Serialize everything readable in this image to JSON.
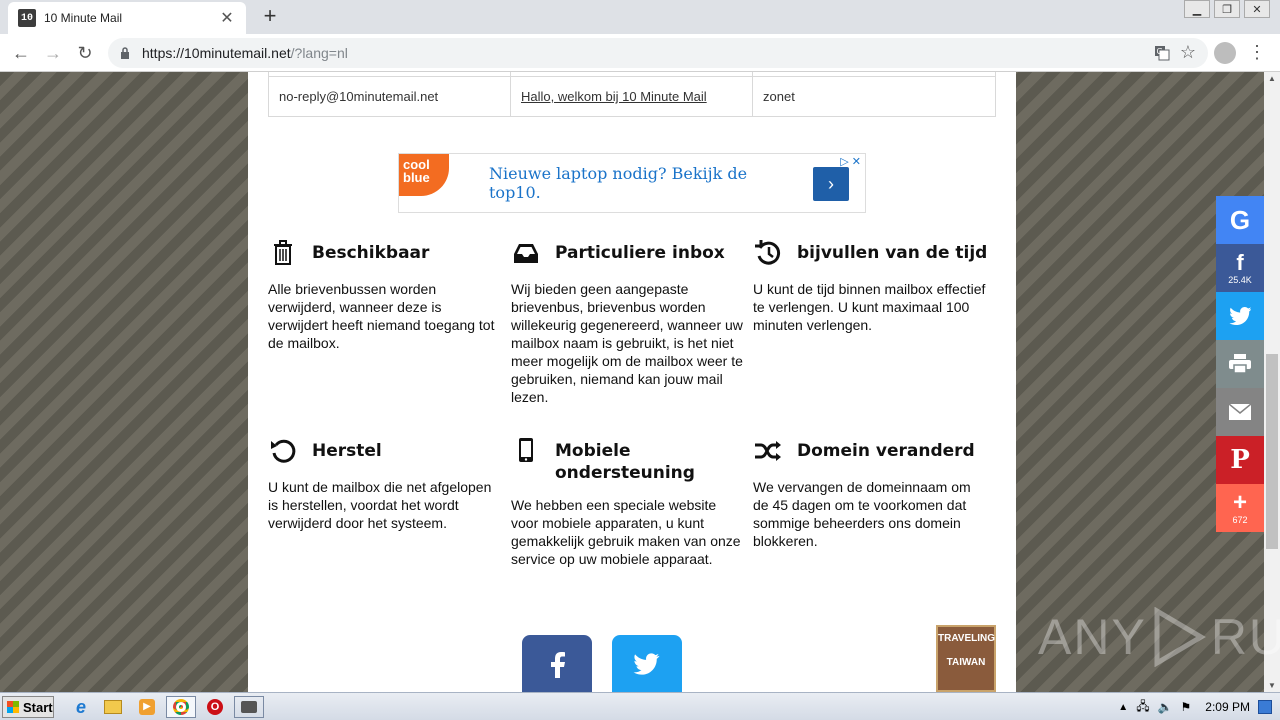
{
  "browser": {
    "tab_title": "10 Minute Mail",
    "favicon_text": "10",
    "url_main": "https://10minutemail.net",
    "url_rest": "/?lang=nl"
  },
  "mail_table": {
    "rows": [
      {
        "from": "no-reply@10minutemail.net",
        "subject": "Hallo, welkom bij 10 Minute Mail",
        "date": "zonet"
      }
    ]
  },
  "ad": {
    "logo_line1": "cool",
    "logo_line2": "blue",
    "text": "Nieuwe laptop nodig? Bekijk de top10."
  },
  "features": [
    {
      "icon": "trash-icon",
      "title": "Beschikbaar",
      "text": "Alle brievenbussen worden verwijderd, wanneer deze is verwijdert heeft niemand toegang tot de mailbox."
    },
    {
      "icon": "inbox-icon",
      "title": "Particuliere inbox",
      "text": "Wij bieden geen aangepaste brievenbus, brievenbus worden willekeurig gegenereerd, wanneer uw mailbox naam is gebruikt, is het niet meer mogelijk om de mailbox weer te gebruiken, niemand kan jouw mail lezen."
    },
    {
      "icon": "history-icon",
      "title": "bijvullen van de tijd",
      "text": "U kunt de tijd binnen mailbox effectief te verlengen. U kunt maximaal 100 minuten verlengen."
    },
    {
      "icon": "restore-icon",
      "title": "Herstel",
      "text": "U kunt de mailbox die net afgelopen is herstellen, voordat het wordt verwijderd door het systeem."
    },
    {
      "icon": "mobile-icon",
      "title": "Mobiele ondersteuning",
      "text": "We hebben een speciale website voor mobiele apparaten, u kunt gemakkelijk gebruik maken van onze service op uw mobiele apparaat."
    },
    {
      "icon": "shuffle-icon",
      "title": "Domein veranderd",
      "text": "We vervangen de domeinnaam om de 45 dagen om te voorkomen dat sommige beheerders ons domein blokkeren."
    }
  ],
  "book": {
    "line1": "TRAVELING",
    "line2": "TAIWAN"
  },
  "share": {
    "facebook_count": "25.4K",
    "more_count": "672",
    "colors": {
      "google": "#4285f4",
      "facebook": "#3b5998",
      "twitter": "#1da1f2",
      "print": "#7f8c8d",
      "email": "#848484",
      "pinterest": "#cb2027",
      "more": "#ff6550"
    }
  },
  "watermark": {
    "left": "ANY",
    "right": "RUN"
  },
  "taskbar": {
    "start_label": "Start",
    "clock": "2:09 PM"
  }
}
